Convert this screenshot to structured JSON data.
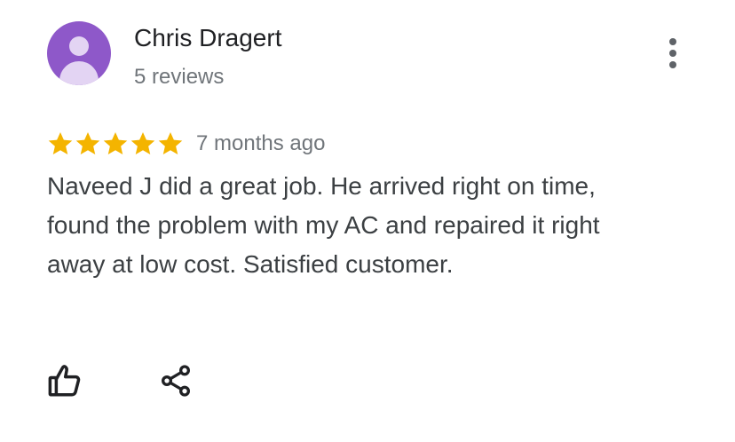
{
  "reviewer": {
    "name": "Chris Dragert",
    "review_count": "5 reviews",
    "avatar_color": "#8e58c9"
  },
  "review": {
    "rating": 5,
    "rating_max": 5,
    "star_color": "#f4b400",
    "time_ago": "7 months ago",
    "text": "Naveed J did a great job.  He arrived right on time, found the problem with my AC and repaired it right away at low cost.  Satisfied customer."
  },
  "icons": {
    "menu": "more-vert-icon",
    "like": "thumb-up-icon",
    "share": "share-icon"
  }
}
